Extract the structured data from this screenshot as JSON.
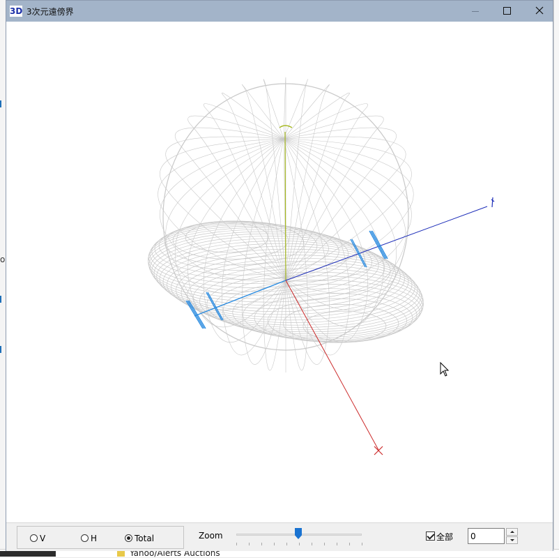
{
  "window": {
    "icon_text": "3D",
    "title": "3次元遠傍界"
  },
  "controls": {
    "radio_options": [
      {
        "label": "V",
        "checked": false
      },
      {
        "label": "H",
        "checked": false
      },
      {
        "label": "Total",
        "checked": true
      }
    ],
    "zoom_label": "Zoom",
    "zoom_level": 0.5,
    "all_checkbox": {
      "label": "全部",
      "checked": true
    },
    "number_value": "0"
  },
  "background": {
    "bottom_text": "Yahoo/Alerts Auctions"
  },
  "colors": {
    "mesh": "#c8c8c8",
    "x_axis": "#cc2a2a",
    "y_axis": "#1a2bb8",
    "z_axis": "#a6b820",
    "markers": "#2a8be0",
    "titlebar": "#a3b4c9",
    "slider_thumb": "#1a73d1"
  }
}
